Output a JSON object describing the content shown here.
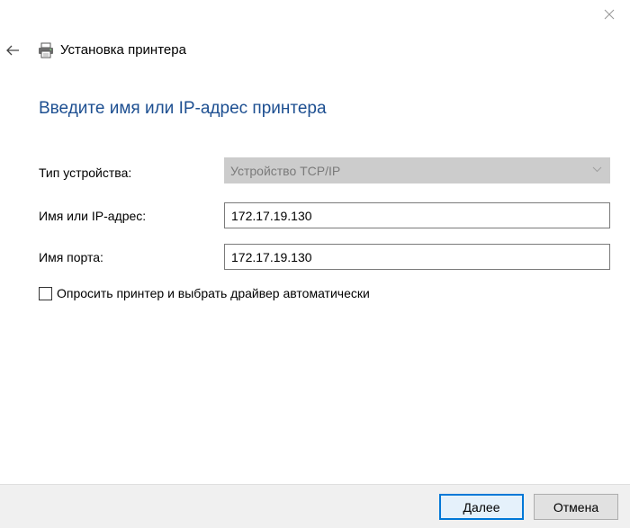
{
  "window": {
    "title": "Установка принтера",
    "close_icon": "close-icon",
    "back_icon": "back-arrow-icon",
    "printer_icon": "printer-icon"
  },
  "main": {
    "heading": "Введите имя или IP-адрес принтера"
  },
  "form": {
    "device_type_label": "Тип устройства:",
    "device_type_value": "Устройство TCP/IP",
    "host_label": "Имя или IP-адрес:",
    "host_value": "172.17.19.130",
    "port_label": "Имя порта:",
    "port_value": "172.17.19.130",
    "query_printer_label": "Опросить принтер и выбрать драйвер автоматически",
    "query_printer_checked": false
  },
  "footer": {
    "next_label": "Далее",
    "cancel_label": "Отмена"
  },
  "colors": {
    "heading": "#1d4f91",
    "accent": "#0078d7",
    "footer_bg": "#f0f0f0",
    "disabled_bg": "#cccccc"
  }
}
